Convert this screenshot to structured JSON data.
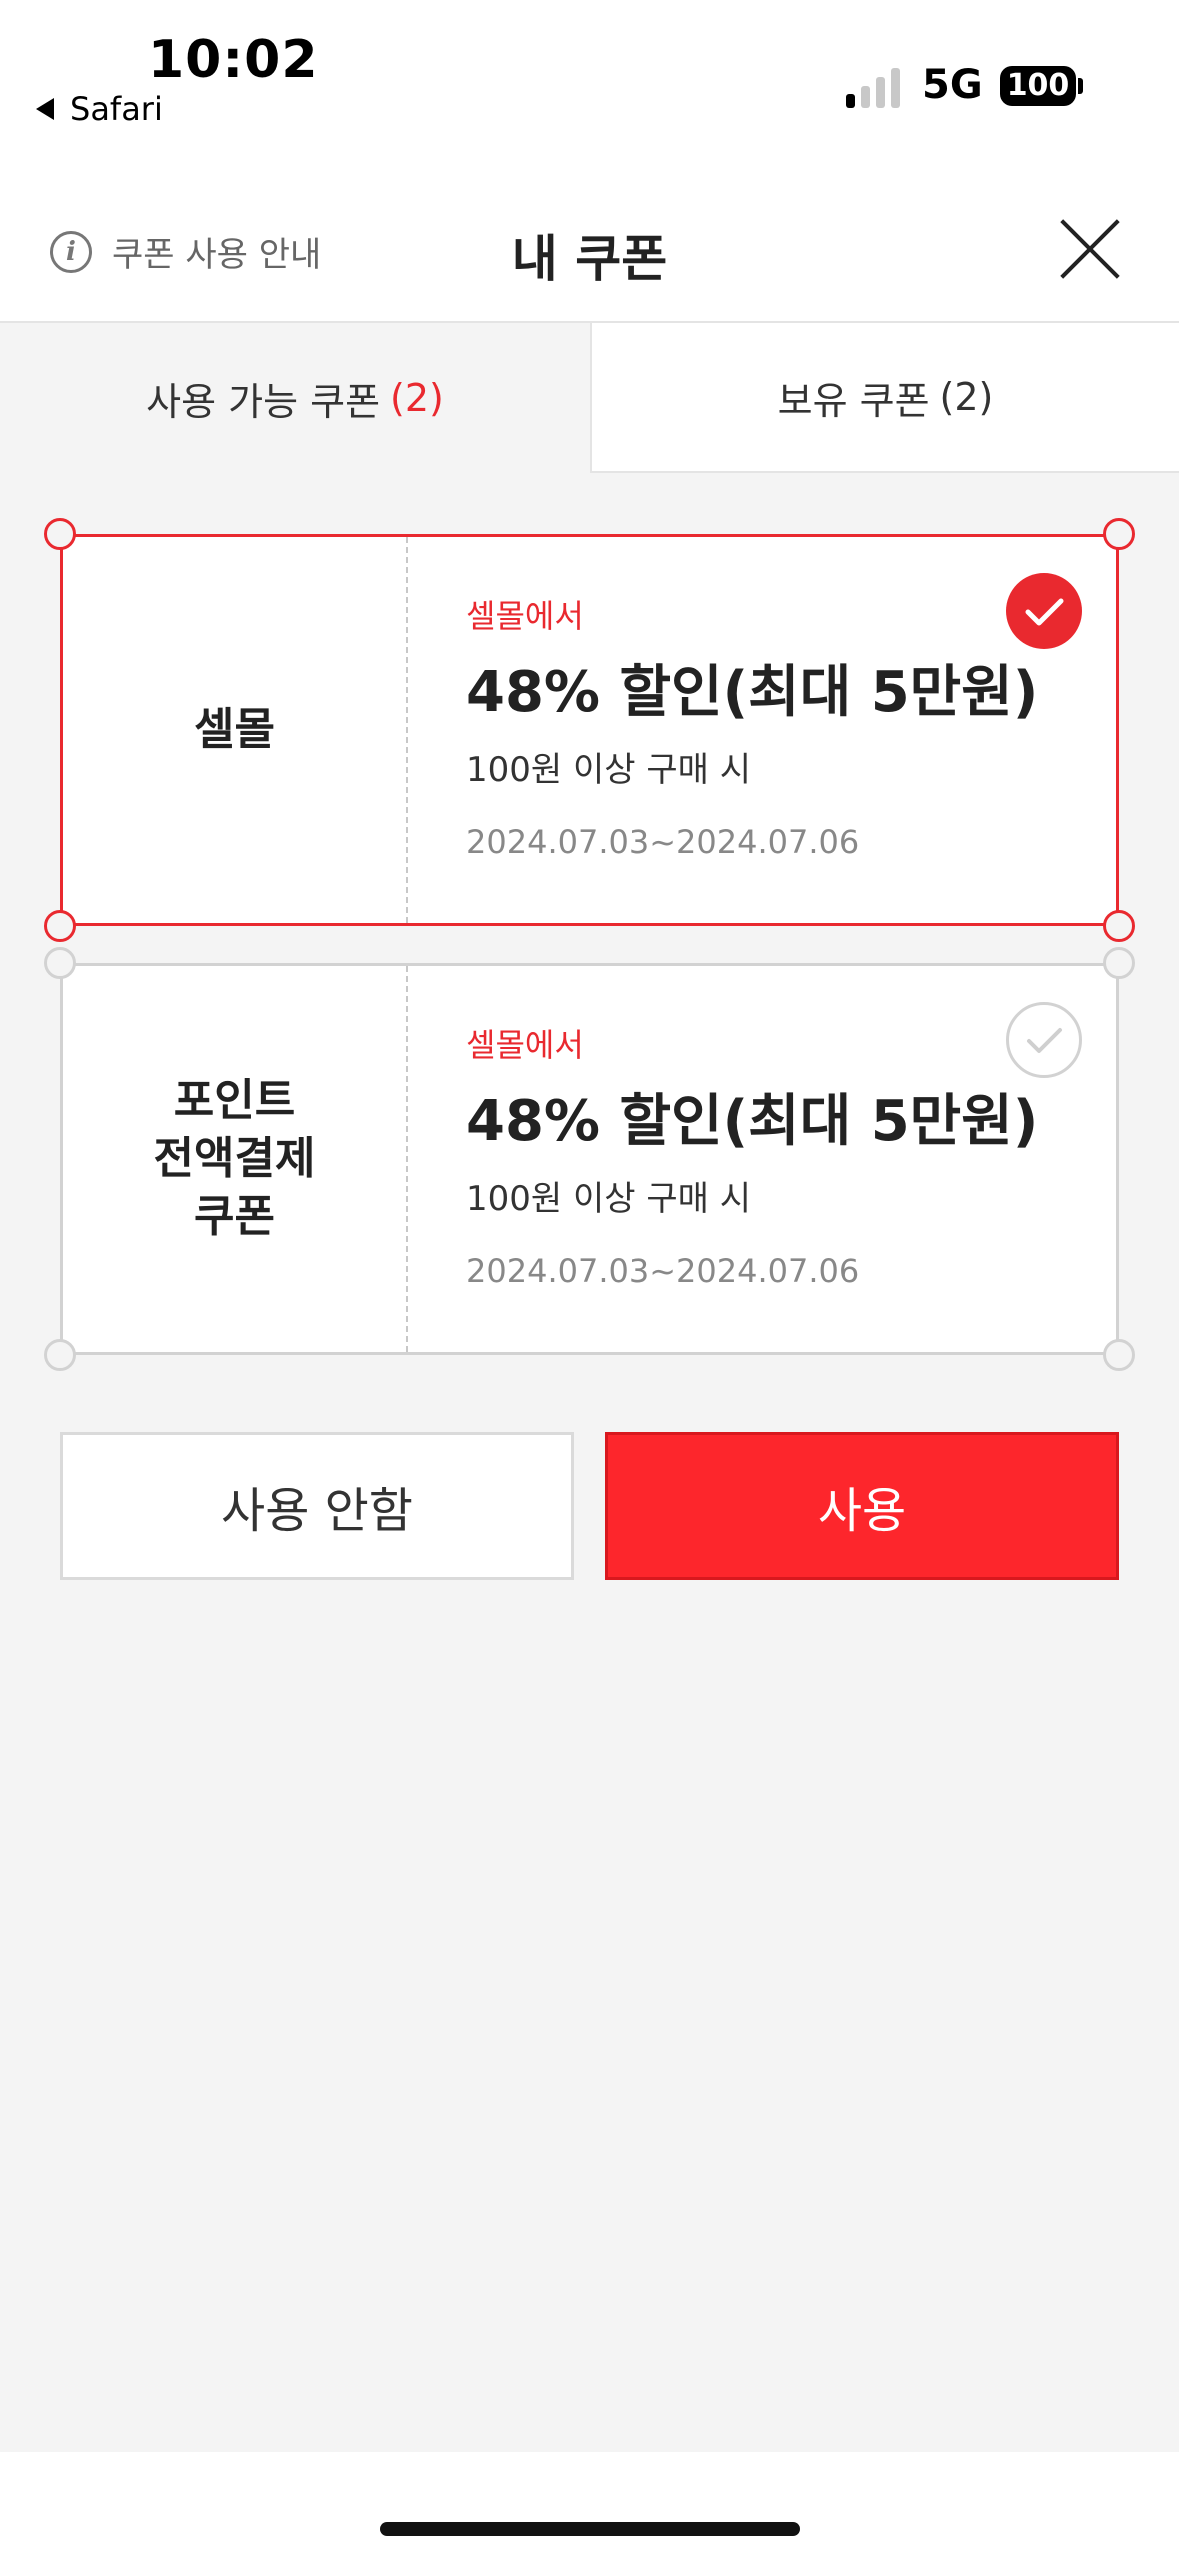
{
  "status_bar": {
    "time": "10:02",
    "back_app": "Safari",
    "network": "5G",
    "battery": "100"
  },
  "header": {
    "guide_label": "쿠폰 사용 안내",
    "title": "내 쿠폰"
  },
  "tabs": [
    {
      "label": "사용 가능 쿠폰",
      "count": "(2)",
      "active": true
    },
    {
      "label": "보유 쿠폰",
      "count": "(2)",
      "active": false
    }
  ],
  "coupons": [
    {
      "name": "셀몰",
      "source": "셀몰에서",
      "discount": "48% 할인(최대 5만원)",
      "condition": "100원 이상 구매 시",
      "period": "2024.07.03~2024.07.06",
      "selected": true
    },
    {
      "name": "포인트\n전액결제\n쿠폰",
      "source": "셀몰에서",
      "discount": "48% 할인(최대 5만원)",
      "condition": "100원 이상 구매 시",
      "period": "2024.07.03~2024.07.06",
      "selected": false
    }
  ],
  "actions": {
    "cancel_label": "사용 안함",
    "use_label": "사용"
  },
  "colors": {
    "accent": "#e9292f",
    "button_red": "#fd262c",
    "background": "#f4f4f4"
  }
}
